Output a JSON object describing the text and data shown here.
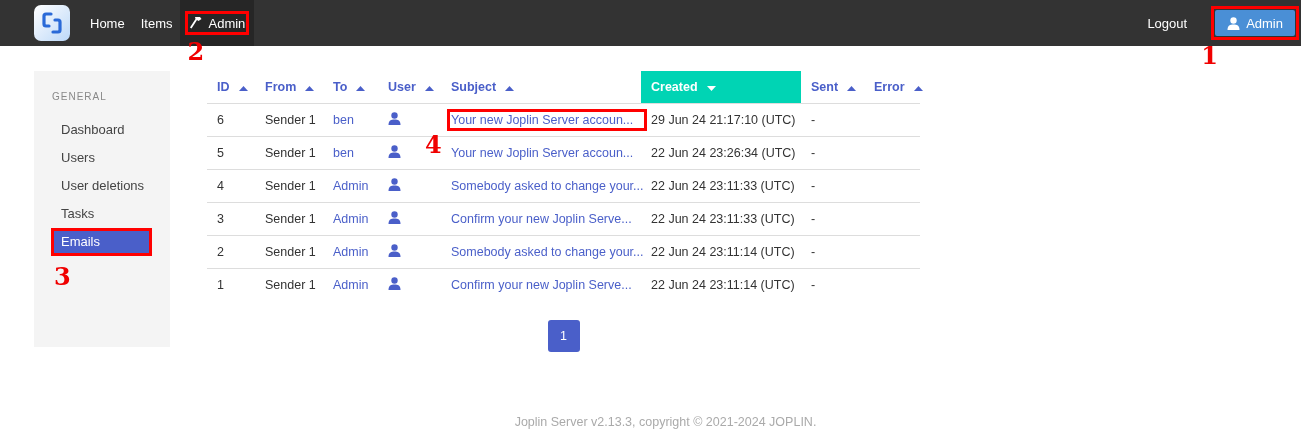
{
  "topbar": {
    "nav": [
      {
        "label": "Home",
        "kind": "plain",
        "selected": false
      },
      {
        "label": "Items",
        "kind": "plain",
        "selected": false
      },
      {
        "label": "Admin",
        "kind": "tool",
        "selected": true,
        "annotation": "2"
      }
    ],
    "logout": "Logout",
    "account": {
      "label": "Admin",
      "annotation": "1"
    }
  },
  "sidebar": {
    "heading": "GENERAL",
    "items": [
      {
        "label": "Dashboard",
        "selected": false
      },
      {
        "label": "Users",
        "selected": false
      },
      {
        "label": "User deletions",
        "selected": false
      },
      {
        "label": "Tasks",
        "selected": false
      },
      {
        "label": "Emails",
        "selected": true,
        "annotation": "3"
      }
    ]
  },
  "table": {
    "columns": [
      {
        "label": "ID",
        "descending": false,
        "selected": false
      },
      {
        "label": "From",
        "descending": false,
        "selected": false
      },
      {
        "label": "To",
        "descending": false,
        "selected": false
      },
      {
        "label": "User",
        "descending": false,
        "selected": false
      },
      {
        "label": "Subject",
        "descending": false,
        "selected": false
      },
      {
        "label": "Created",
        "descending": true,
        "selected": true
      },
      {
        "label": "Sent",
        "descending": false,
        "selected": false
      },
      {
        "label": "Error",
        "descending": false,
        "selected": false
      }
    ],
    "rows": [
      {
        "id": "6",
        "from": "Sender 1",
        "to": "ben",
        "subject": "Your new Joplin Server accoun...",
        "subject_annotation": "4",
        "created": "29 Jun 24 21:17:10 (UTC)",
        "sent": "-"
      },
      {
        "id": "5",
        "from": "Sender 1",
        "to": "ben",
        "subject": "Your new Joplin Server accoun...",
        "created": "22 Jun 24 23:26:34 (UTC)",
        "sent": "-"
      },
      {
        "id": "4",
        "from": "Sender 1",
        "to": "Admin",
        "subject": "Somebody asked to change your...",
        "created": "22 Jun 24 23:11:33 (UTC)",
        "sent": "-"
      },
      {
        "id": "3",
        "from": "Sender 1",
        "to": "Admin",
        "subject": "Confirm your new Joplin Serve...",
        "created": "22 Jun 24 23:11:33 (UTC)",
        "sent": "-"
      },
      {
        "id": "2",
        "from": "Sender 1",
        "to": "Admin",
        "subject": "Somebody asked to change your...",
        "created": "22 Jun 24 23:11:14 (UTC)",
        "sent": "-"
      },
      {
        "id": "1",
        "from": "Sender 1",
        "to": "Admin",
        "subject": "Confirm your new Joplin Serve...",
        "created": "22 Jun 24 23:11:14 (UTC)",
        "sent": "-"
      }
    ]
  },
  "pagination": [
    {
      "label": "1",
      "selected": true
    }
  ],
  "footer": "Joplin Server v2.13.3, copyright © 2021-2024 JOPLIN."
}
